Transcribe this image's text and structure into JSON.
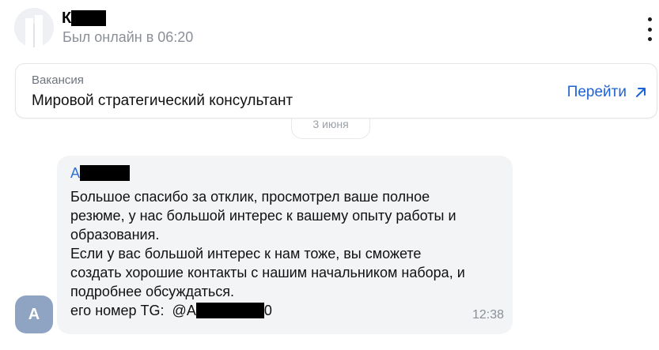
{
  "header": {
    "contact_initial": "К",
    "status": "Был онлайн в 06:20",
    "menu_icon": "kebab-menu-icon"
  },
  "vacancy": {
    "caption": "Вакансия",
    "title": "Мировой стратегический консультант",
    "go_label": "Перейти",
    "go_icon": "arrow-up-right-icon",
    "accent": "#1e63d6"
  },
  "date_chip": {
    "label": "3 июня"
  },
  "message": {
    "avatar_letter": "А",
    "sender_initial": "А",
    "lines": [
      "Большое спасибо за отклик, просмотрел ваше полное",
      "резюме, у нас большой интерес к вашему опыту работы и",
      "образования.",
      "Если у вас большой интерес к нам тоже, вы сможете",
      "создать хорошие контакты с нашим начальником набора, и",
      "подробнее обсуждаться."
    ],
    "tg_prefix": "его номер TG:  @А",
    "tg_suffix": "0",
    "time": "12:38"
  },
  "colors": {
    "bubble_bg": "#f3f4f6",
    "sender": "#2f6fd6",
    "avatar_bg": "#8ea4c2"
  }
}
